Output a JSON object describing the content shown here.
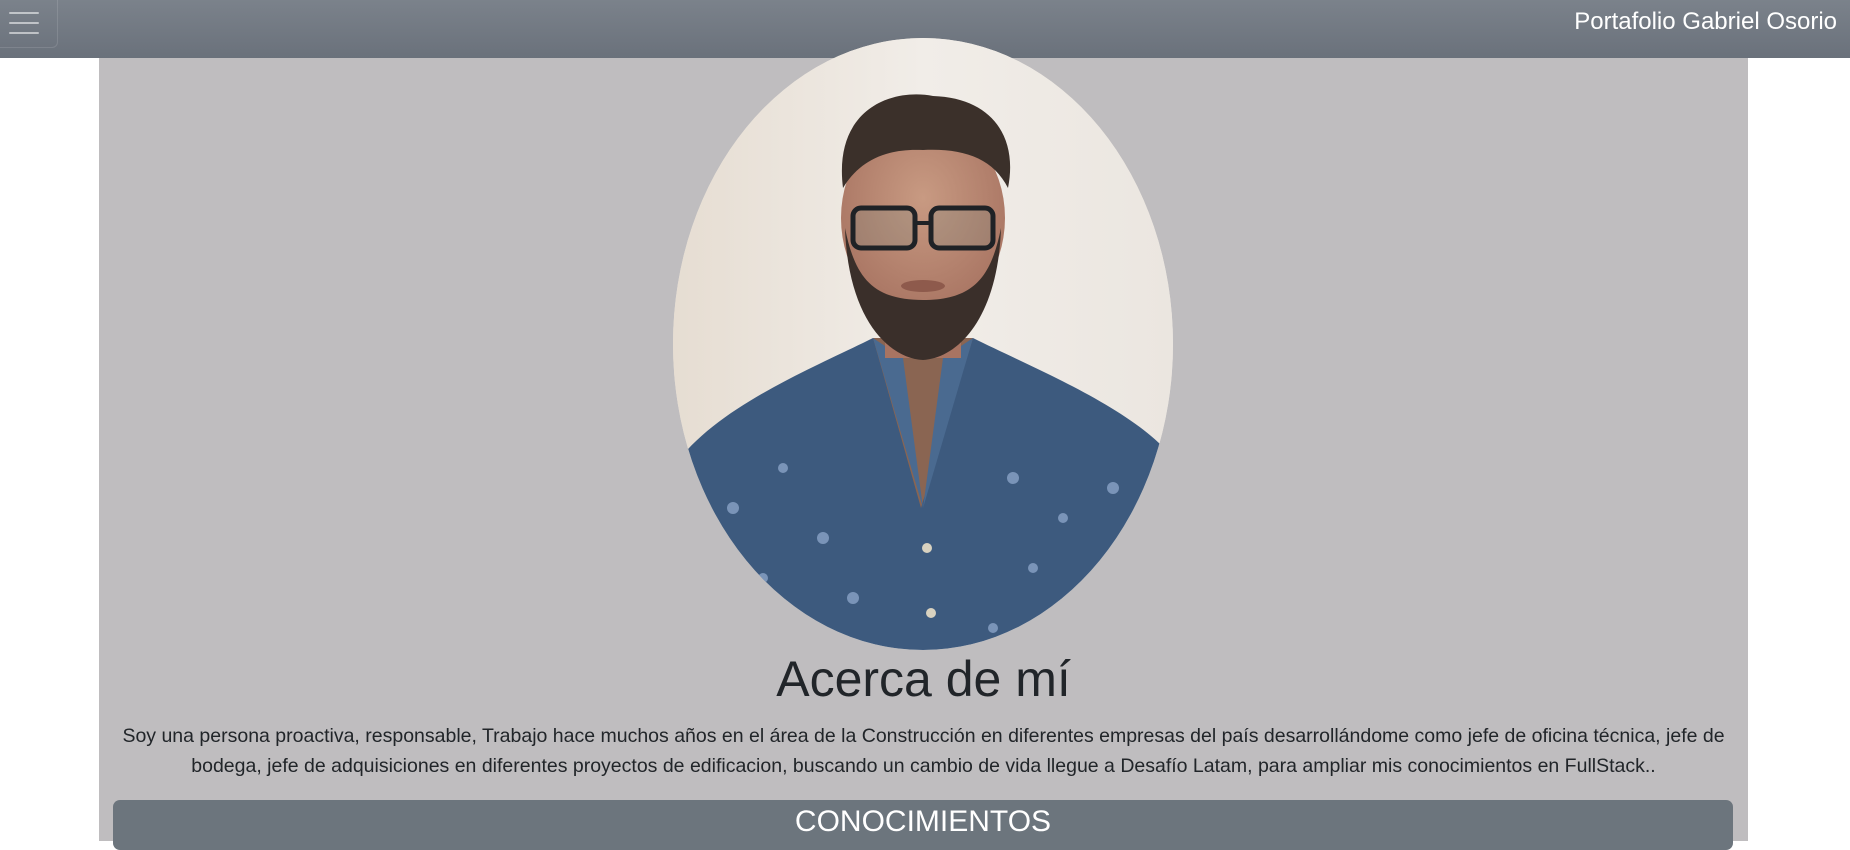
{
  "navbar": {
    "brand": "Portafolio Gabriel Osorio",
    "menu_icon": "hamburger-menu-icon"
  },
  "about": {
    "photo_alt": "Gabriel Osorio",
    "title": "Acerca de mí",
    "text": "Soy una persona proactiva, responsable, Trabajo hace muchos años en el área de la Construcción en diferentes empresas del país desarrollándome como jefe de oficina técnica, jefe de bodega, jefe de adquisiciones en diferentes proyectos de edificacion, buscando un cambio de vida llegue a Desafío Latam, para ampliar mis conocimientos en FullStack.."
  },
  "sections": {
    "knowledge_title": "CONOCIMIENTOS"
  },
  "colors": {
    "navbar": "#6c757d",
    "main_background": "#bfbdbf",
    "section_bar": "#6c757d"
  }
}
